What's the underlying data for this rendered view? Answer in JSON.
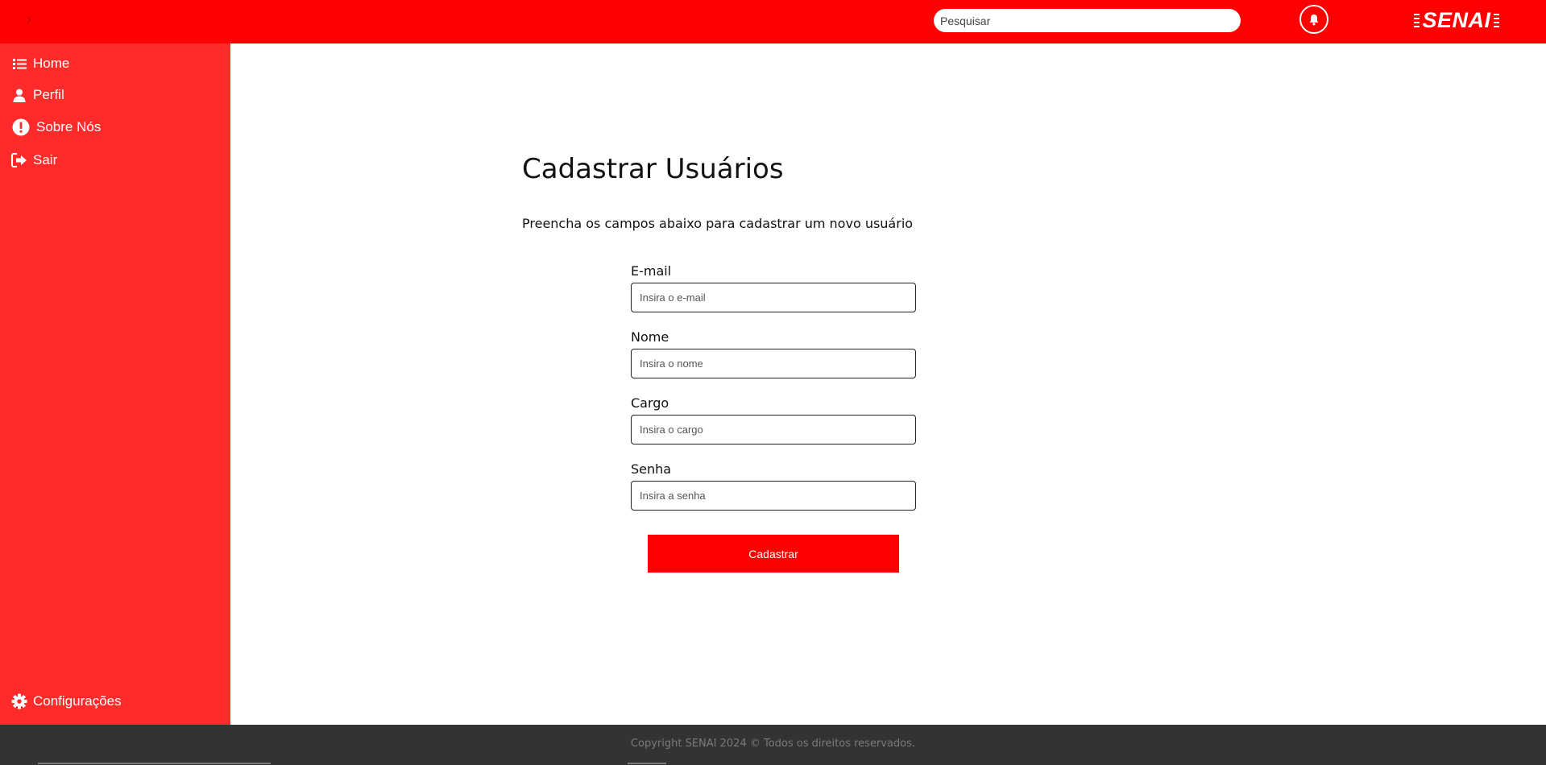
{
  "header": {
    "toggle_icon": "chevron-right-icon",
    "search_placeholder": "Pesquisar",
    "notification_icon": "bell-icon",
    "logo_text": "SENAI",
    "background_color": "#ff0000"
  },
  "sidebar": {
    "background_color": "#ff2a2a",
    "items": [
      {
        "label": "Home",
        "icon": "list-icon"
      },
      {
        "label": "Perfil",
        "icon": "user-icon"
      },
      {
        "label": "Sobre Nós",
        "icon": "exclamation-circle-icon"
      },
      {
        "label": "Sair",
        "icon": "sign-out-icon"
      }
    ],
    "settings": {
      "label": "Configurações",
      "icon": "gear-icon"
    }
  },
  "main": {
    "title": "Cadastrar Usuários",
    "subtitle": "Preencha os campos abaixo para cadastrar um novo usuário",
    "fields": [
      {
        "label": "E-mail",
        "placeholder": "Insira o e-mail",
        "value": ""
      },
      {
        "label": "Nome",
        "placeholder": "Insira o nome",
        "value": ""
      },
      {
        "label": "Cargo",
        "placeholder": "Insira o cargo",
        "value": ""
      },
      {
        "label": "Senha",
        "placeholder": "Insira a senha",
        "value": ""
      }
    ],
    "submit_label": "Cadastrar",
    "accent_color": "#ff0000"
  },
  "footer": {
    "text": "Copyright SENAI 2024 © Todos os direitos reservados.",
    "background_color": "#333333"
  }
}
